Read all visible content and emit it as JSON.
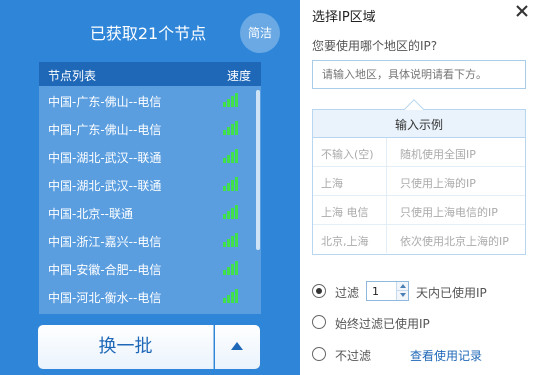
{
  "left": {
    "title": "已获取21个节点",
    "simple_btn": "简洁",
    "list_header": {
      "name": "节点列表",
      "speed": "速度"
    },
    "nodes": [
      {
        "name": "中国-广东-佛山--电信",
        "signal_level": 4
      },
      {
        "name": "中国-广东-佛山--电信",
        "signal_level": 4
      },
      {
        "name": "中国-湖北-武汉--联通",
        "signal_level": 4
      },
      {
        "name": "中国-湖北-武汉--联通",
        "signal_level": 4
      },
      {
        "name": "中国-北京--联通",
        "signal_level": 4
      },
      {
        "name": "中国-浙江-嘉兴--电信",
        "signal_level": 4
      },
      {
        "name": "中国-安徽-合肥--电信",
        "signal_level": 4
      },
      {
        "name": "中国-河北-衡水--电信",
        "signal_level": 4
      }
    ],
    "refresh_btn": "换一批",
    "more_icon": "triangle-up-icon"
  },
  "right": {
    "title": "选择IP区域",
    "close_icon": "close-icon",
    "question": "您要使用哪个地区的IP?",
    "input_placeholder": "请输入地区，具体说明请看下方。",
    "example_header": "输入示例",
    "examples": [
      {
        "input": "不输入(空)",
        "meaning": "随机使用全国IP"
      },
      {
        "input": "上海",
        "meaning": "只使用上海的IP"
      },
      {
        "input": "上海 电信",
        "meaning": "只使用上海电信的IP"
      },
      {
        "input": "北京,上海",
        "meaning": "依次使用北京上海的IP"
      }
    ],
    "options": {
      "filter_label": "过滤",
      "days_value": "1",
      "days_suffix": "天内已使用IP",
      "always_filter": "始终过滤已使用IP",
      "no_filter": "不过滤",
      "history_link": "查看使用记录",
      "selected": "filter"
    }
  },
  "colors": {
    "left_bg": "#2f86d8",
    "list_bg": "#5a9ee0",
    "list_header_bg": "#1f68b8",
    "signal_green": "#3fe04a",
    "link_blue": "#1f68b8"
  }
}
